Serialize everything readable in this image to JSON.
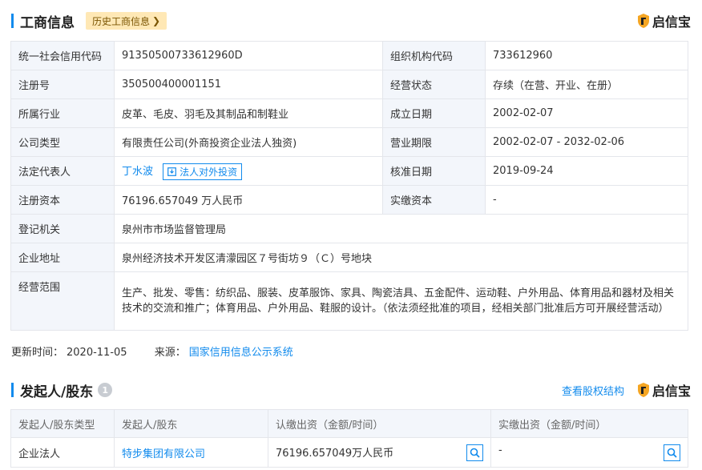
{
  "business_info": {
    "title": "工商信息",
    "history_label": "历史工商信息",
    "brand": "启信宝",
    "rows": [
      {
        "l1": "统一社会信用代码",
        "v1": "91350500733612960D",
        "l2": "组织机构代码",
        "v2": "733612960"
      },
      {
        "l1": "注册号",
        "v1": "350500400001151",
        "l2": "经营状态",
        "v2": "存续（在营、开业、在册）"
      },
      {
        "l1": "所属行业",
        "v1": "皮革、毛皮、羽毛及其制品和制鞋业",
        "l2": "成立日期",
        "v2": "2002-02-07"
      },
      {
        "l1": "公司类型",
        "v1": "有限责任公司(外商投资企业法人独资)",
        "l2": "营业期限",
        "v2": "2002-02-07 - 2032-02-06"
      },
      {
        "l1": "法定代表人",
        "v1": "丁水波",
        "v1_button": "法人对外投资",
        "l2": "核准日期",
        "v2": "2019-09-24"
      },
      {
        "l1": "注册资本",
        "v1": "76196.657049 万人民币",
        "l2": "实缴资本",
        "v2": "-"
      }
    ],
    "full_rows": [
      {
        "l": "登记机关",
        "v": "泉州市市场监督管理局"
      },
      {
        "l": "企业地址",
        "v": "泉州经济技术开发区清濛园区７号街坊９（Ｃ）号地块"
      },
      {
        "l": "经营范围",
        "v": "生产、批发、零售：纺织品、服装、皮革服饰、家具、陶瓷洁具、五金配件、运动鞋、户外用品、体育用品和器材及相关技术的交流和推广；体育用品、户外用品、鞋服的设计。（依法须经批准的项目，经相关部门批准后方可开展经营活动）"
      }
    ],
    "update_label": "更新时间：",
    "update_time": "2020-11-05",
    "source_label": "来源：",
    "source": "国家信用信息公示系统"
  },
  "shareholders": {
    "title": "发起人/股东",
    "count": "1",
    "equity_link": "查看股权结构",
    "brand": "启信宝",
    "headers": [
      "发起人/股东类型",
      "发起人/股东",
      "认缴出资（金额/时间）",
      "实缴出资（金额/时间）"
    ],
    "rows": [
      {
        "type": "企业法人",
        "name": "特步集团有限公司",
        "subscribed": "76196.657049万人民币",
        "paid": "-"
      }
    ]
  },
  "colors": {
    "accent": "#128bed",
    "label_bg": "#f3f6fb",
    "history_bg": "#ffe8b5",
    "border": "#e4e6eb"
  }
}
